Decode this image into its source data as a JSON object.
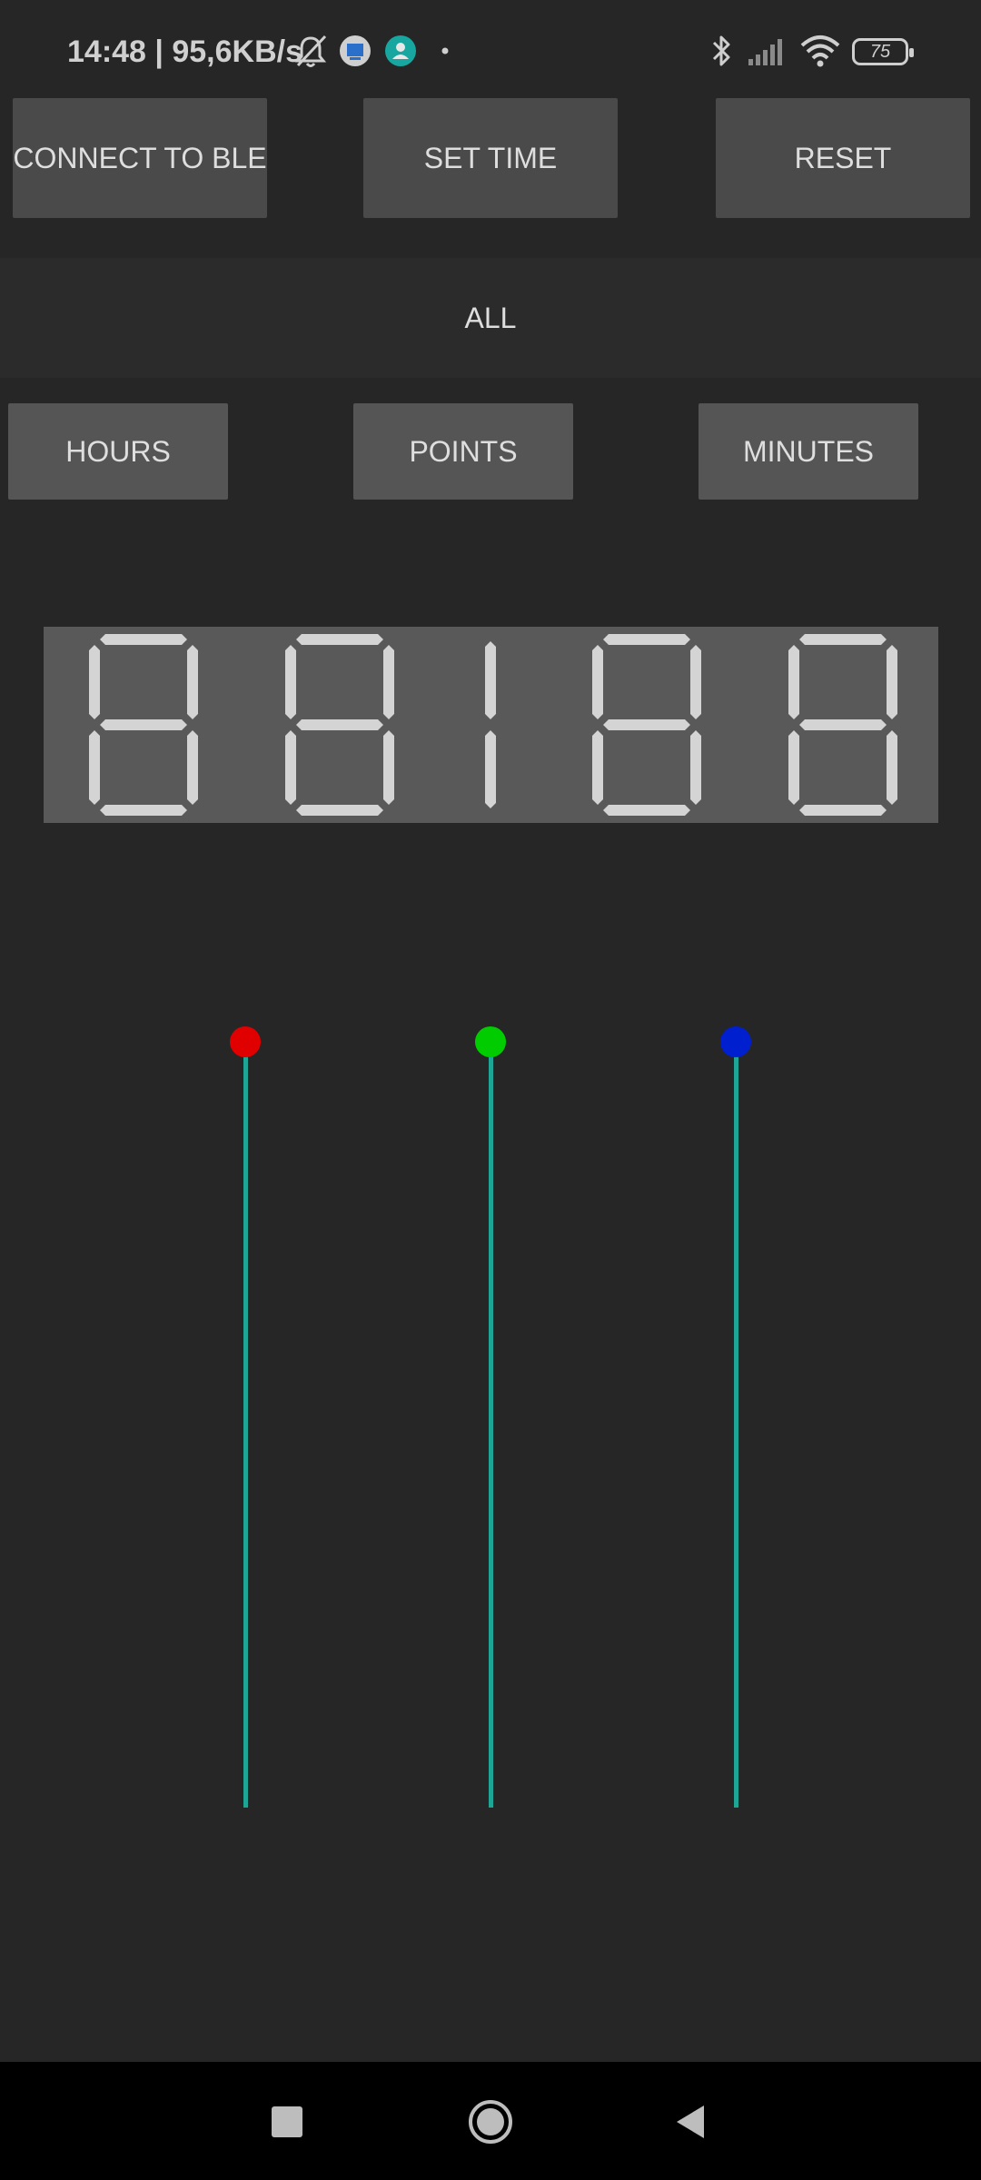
{
  "status_bar": {
    "time_speed": "14:48 | 95,6KB/s",
    "battery_level": "75",
    "icons": [
      "bell-off-icon",
      "app-notification-icon",
      "app-notification-icon",
      "dot-icon",
      "bluetooth-icon",
      "signal-icon",
      "wifi-icon",
      "battery-icon"
    ]
  },
  "toolbar": {
    "connect_label": "CONNECT TO BLE",
    "set_time_label": "SET TIME",
    "reset_label": "RESET"
  },
  "all_label": "ALL",
  "segments": {
    "hours_label": "HOURS",
    "points_label": "POINTS",
    "minutes_label": "MINUTES"
  },
  "color_sliders": [
    {
      "name": "red",
      "color": "#e00000",
      "value": 1.0
    },
    {
      "name": "green",
      "color": "#00cc00",
      "value": 1.0
    },
    {
      "name": "blue",
      "color": "#0020d0",
      "value": 1.0
    }
  ],
  "colors": {
    "segment_on": "#d4d4d4",
    "track": "#1fa595",
    "button": "#4a4a4a"
  },
  "navigation": {
    "icons": [
      "recents-square-icon",
      "home-circle-icon",
      "back-triangle-icon"
    ]
  }
}
